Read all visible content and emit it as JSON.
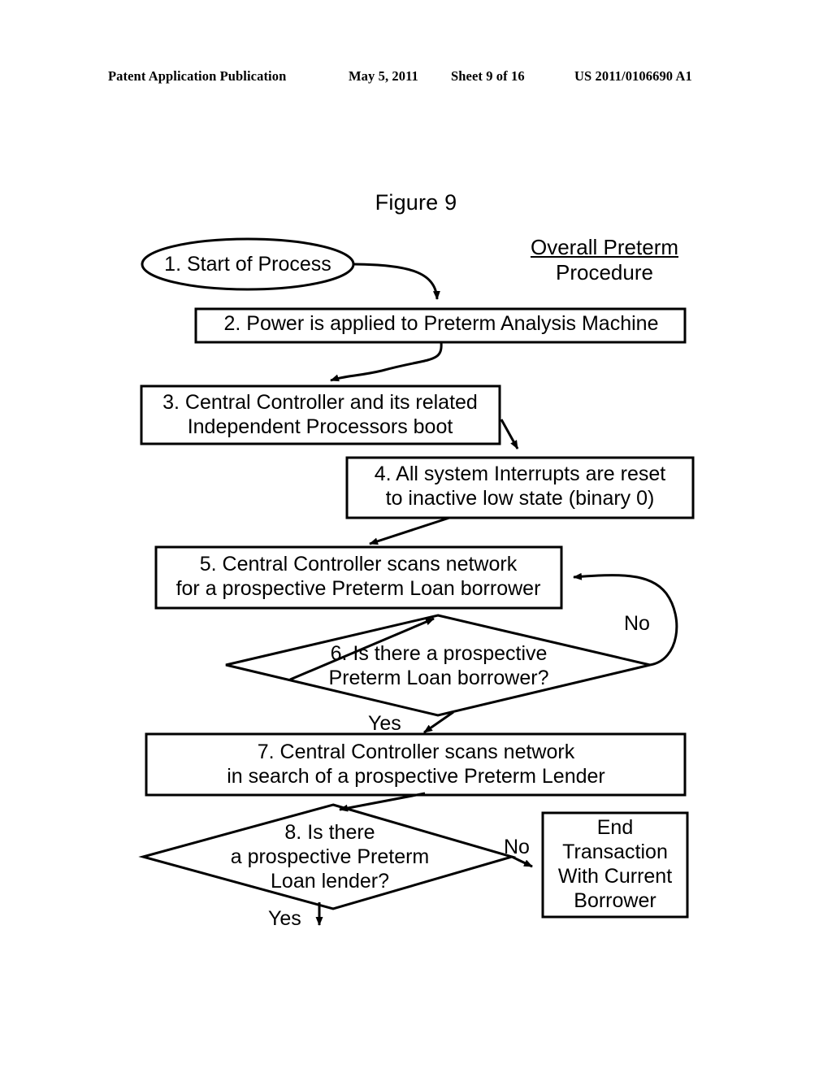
{
  "header": {
    "publication": "Patent Application Publication",
    "date": "May 5, 2011",
    "sheet": "Sheet 9 of 16",
    "patent_number": "US 2011/0106690 A1"
  },
  "figure": {
    "title": "Figure 9",
    "caption_line1": "Overall Preterm",
    "caption_line2": "Procedure"
  },
  "nodes": {
    "n1": {
      "shape": "ellipse",
      "text": "1. Start of Process"
    },
    "n2": {
      "shape": "rect",
      "text": "2. Power is applied to Preterm Analysis Machine"
    },
    "n3": {
      "shape": "rect",
      "line1": "3. Central Controller and its related",
      "line2": "Independent Processors boot"
    },
    "n4": {
      "shape": "rect",
      "line1": "4. All system Interrupts are reset",
      "line2": "to inactive low state (binary 0)"
    },
    "n5": {
      "shape": "rect",
      "line1": "5. Central Controller scans network",
      "line2": "for a prospective Preterm Loan borrower"
    },
    "n6": {
      "shape": "diamond",
      "line1": "6. Is there a prospective",
      "line2": "Preterm Loan borrower?"
    },
    "n7": {
      "shape": "rect",
      "line1": "7. Central Controller scans network",
      "line2": "in search of a prospective Preterm Lender"
    },
    "n8": {
      "shape": "diamond",
      "line1": "8. Is there",
      "line2": "a prospective Preterm",
      "line3": "Loan lender?"
    },
    "n_end": {
      "shape": "rect",
      "line1": "End",
      "line2": "Transaction",
      "line3": "With Current",
      "line4": "Borrower"
    }
  },
  "edge_labels": {
    "no_from_6": "No",
    "yes_from_6": "Yes",
    "no_from_8": "No",
    "yes_from_8": "Yes"
  },
  "colors": {
    "ink": "#000000",
    "paper": "#ffffff"
  }
}
